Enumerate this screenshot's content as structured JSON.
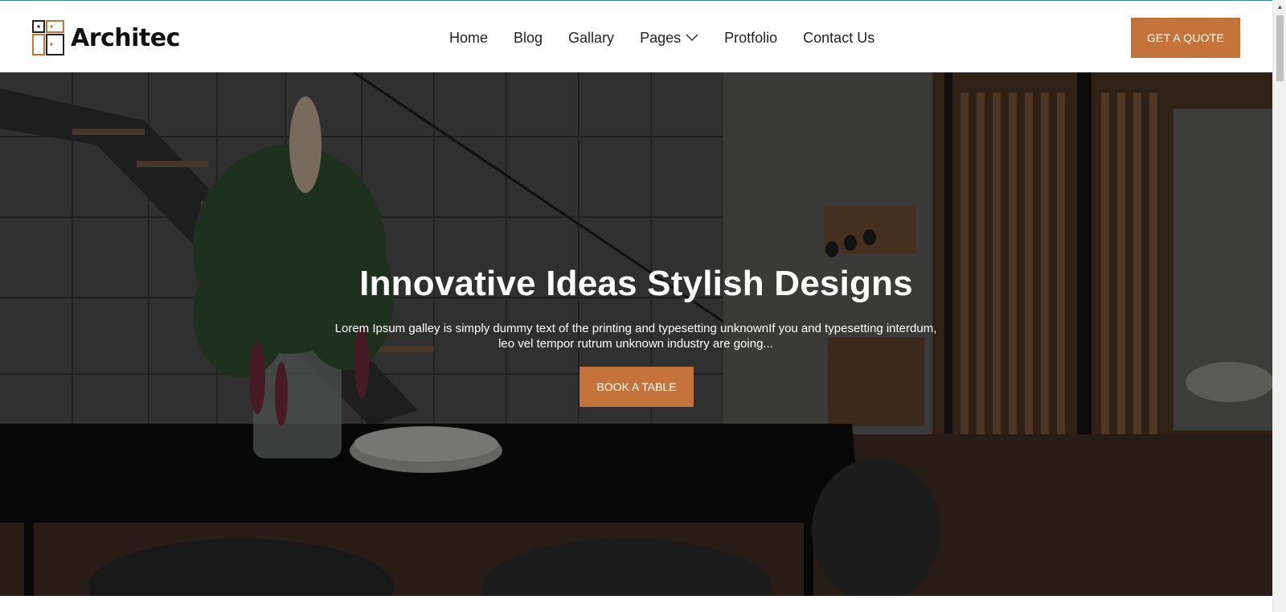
{
  "brand": {
    "name": "Architec",
    "accent_color": "#c4743a",
    "logo_icon": "architec-logo-icon"
  },
  "nav": {
    "items": [
      {
        "label": "Home"
      },
      {
        "label": "Blog"
      },
      {
        "label": "Gallary"
      },
      {
        "label": "Pages",
        "icon": "chevron-down-icon"
      },
      {
        "label": "Protfolio"
      },
      {
        "label": "Contact Us"
      }
    ]
  },
  "header": {
    "cta_label": "GET A QUOTE"
  },
  "hero": {
    "title": "Innovative Ideas Stylish Designs",
    "text": "Lorem Ipsum galley is simply dummy text of the printing and typesetting unknownIf you and typesetting interdum, leo vel tempor rutrum unknown industry are going...",
    "button_label": "BOOK A TABLE",
    "background": "dark modern interior with dining table, plant vase and staircase"
  }
}
